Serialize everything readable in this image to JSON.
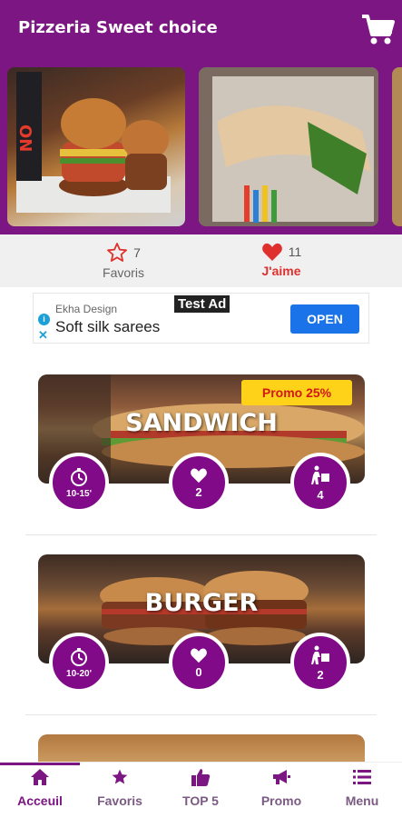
{
  "app": {
    "title": "Pizzeria Sweet choice"
  },
  "colors": {
    "primary": "#7b1682",
    "accent_red": "#e0302d",
    "promo_bg": "#ffd21a",
    "ad_button": "#1a73e8"
  },
  "carousel": {
    "images": [
      {
        "name": "burger-photo"
      },
      {
        "name": "wrap-photo"
      },
      {
        "name": "partial-photo"
      }
    ]
  },
  "stats": {
    "favorites": {
      "count": "7",
      "label": "Favoris",
      "icon": "star-outline-icon"
    },
    "likes": {
      "count": "11",
      "label": "J'aime",
      "icon": "heart-icon"
    }
  },
  "ad": {
    "test_label": "Test Ad",
    "company": "Ekha Design",
    "title": "Soft silk sarees",
    "button": "OPEN"
  },
  "categories": [
    {
      "title": "SANDWICH",
      "promo": "Promo 25%",
      "time": "10-15'",
      "likes": "2",
      "deliveries": "4"
    },
    {
      "title": "BURGER",
      "time": "10-20'",
      "likes": "0",
      "deliveries": "2"
    }
  ],
  "nav": {
    "items": [
      {
        "label": "Acceuil",
        "icon": "home-icon",
        "active": true
      },
      {
        "label": "Favoris",
        "icon": "star-icon"
      },
      {
        "label": "TOP 5",
        "icon": "thumbs-up-icon"
      },
      {
        "label": "Promo",
        "icon": "megaphone-icon"
      },
      {
        "label": "Menu",
        "icon": "list-icon"
      }
    ]
  }
}
